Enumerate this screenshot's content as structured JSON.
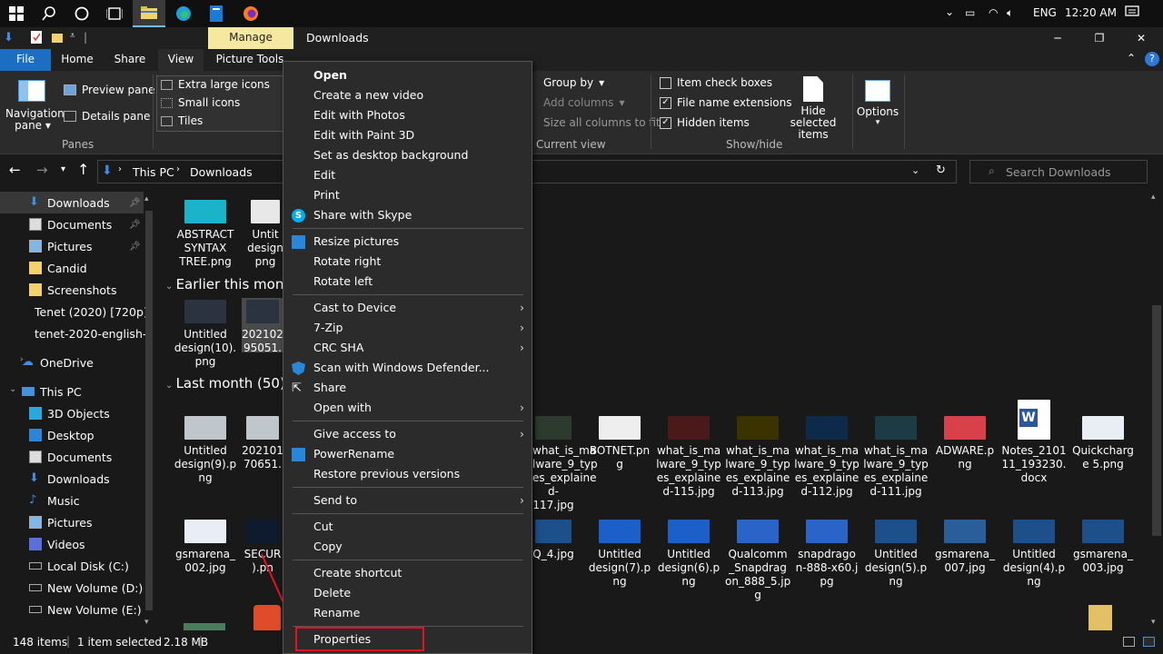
{
  "taskbar": {
    "tray_language": "ENG",
    "tray_time": "12:20 AM"
  },
  "titlebar": {
    "context_tab": "Manage",
    "title": "Downloads"
  },
  "ribbon_tabs": [
    "File",
    "Home",
    "Share",
    "View",
    "Picture Tools"
  ],
  "ribbon": {
    "nav_pane_label": "Navigation pane",
    "preview_pane": "Preview pane",
    "details_pane": "Details pane",
    "panes_group": "Panes",
    "layout_extra_large": "Extra large icons",
    "layout_small": "Small icons",
    "layout_tiles": "Tiles",
    "group_by": "Group by",
    "add_columns": "Add columns",
    "size_columns": "Size all columns to fit",
    "current_view_group": "Current view",
    "item_check_boxes": "Item check boxes",
    "file_name_extensions": "File name extensions",
    "hidden_items": "Hidden items",
    "hide_selected": "Hide selected items",
    "show_hide_group": "Show/hide",
    "options": "Options",
    "item_check_boxes_checked": false,
    "file_name_extensions_checked": true,
    "hidden_items_checked": true
  },
  "address": {
    "breadcrumb_1": "This PC",
    "breadcrumb_2": "Downloads",
    "search_placeholder": "Search Downloads"
  },
  "nav": [
    {
      "label": "Downloads",
      "pinned": true,
      "selected": true
    },
    {
      "label": "Documents",
      "pinned": true
    },
    {
      "label": "Pictures",
      "pinned": true
    },
    {
      "label": "Candid"
    },
    {
      "label": "Screenshots"
    },
    {
      "label": "Tenet (2020) [720p]"
    },
    {
      "label": "tenet-2020-english-"
    },
    {
      "label": "OneDrive"
    },
    {
      "label": "This PC"
    },
    {
      "label": "3D Objects"
    },
    {
      "label": "Desktop"
    },
    {
      "label": "Documents"
    },
    {
      "label": "Downloads"
    },
    {
      "label": "Music"
    },
    {
      "label": "Pictures"
    },
    {
      "label": "Videos"
    },
    {
      "label": "Local Disk (C:)"
    },
    {
      "label": "New Volume (D:)"
    },
    {
      "label": "New Volume (E:)"
    }
  ],
  "content": {
    "group_earlier": "Earlier this month",
    "group_last_month": "Last month (50)",
    "files": [
      "ABSTRACT SYNTAX TREE.png",
      "Untit design png",
      "Untitled design(10). png",
      "202102 95051.",
      "Untitled design(9).p ng",
      "202101 70651.",
      "what_is_ma lware_9_typ es_explaine d-117.jpg",
      "BOTNET.pn g",
      "what_is_ma lware_9_typ es_explaine d-115.jpg",
      "what_is_ma lware_9_typ es_explaine d-113.jpg",
      "what_is_ma lware_9_typ es_explaine d-112.jpg",
      "what_is_ma lware_9_typ es_explaine d-111.jpg",
      "ADWARE.p ng",
      "Notes_2101 11_193230. docx",
      "Quickcharg e 5.png",
      "gsmarena_ 002.jpg",
      "SECUR ).pn",
      "Q_4.jpg",
      "Untitled design(7).p ng",
      "Untitled design(6).p ng",
      "Qualcomm _Snapdrag on_888_5.jp g",
      "snapdrago n-888-x60.j pg",
      "Untitled design(5).p ng",
      "gsmarena_ 007.jpg",
      "Untitled design(4).p ng",
      "gsmarena_ 003.jpg"
    ]
  },
  "status": {
    "items": "148 items",
    "selected": "1 item selected",
    "size": "2.18 MB"
  },
  "context_menu": {
    "items": [
      "Open",
      "Create a new video",
      "Edit with Photos",
      "Edit with Paint 3D",
      "Set as desktop background",
      "Edit",
      "Print",
      "Share with Skype",
      "Resize pictures",
      "Rotate right",
      "Rotate left",
      "Cast to Device",
      "7-Zip",
      "CRC SHA",
      "Scan with Windows Defender...",
      "Share",
      "Open with",
      "Give access to",
      "PowerRename",
      "Restore previous versions",
      "Send to",
      "Cut",
      "Copy",
      "Create shortcut",
      "Delete",
      "Rename",
      "Properties"
    ]
  },
  "colors": {
    "accent": "#0078d7",
    "highlight_box": "#e81123",
    "context_tab": "#f7e89f",
    "folder": "#f3d26b"
  }
}
